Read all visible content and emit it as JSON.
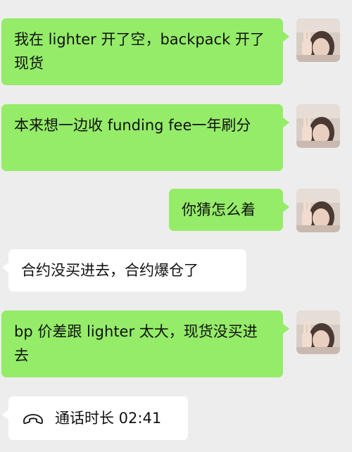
{
  "messages": [
    {
      "side": "out",
      "text": "我在 lighter 开了空，backpack 开了现货",
      "avatar": "contact-avatar"
    },
    {
      "side": "out",
      "text": "本来想一边收 funding fee一年刷分",
      "avatar": "contact-avatar"
    },
    {
      "side": "out",
      "text": "你猜怎么着",
      "avatar": "contact-avatar"
    },
    {
      "side": "in",
      "text": "合约没买进去，合约爆仓了"
    },
    {
      "side": "out",
      "text": "bp 价差跟 lighter 太大，现货没买进去",
      "avatar": "contact-avatar"
    },
    {
      "side": "in",
      "type": "call",
      "icon": "phone-hangup-icon",
      "text": "通话时长 02:41"
    }
  ],
  "colors": {
    "background": "#ededed",
    "outgoing_bubble": "#95ec69",
    "incoming_bubble": "#ffffff",
    "text": "#111111"
  }
}
